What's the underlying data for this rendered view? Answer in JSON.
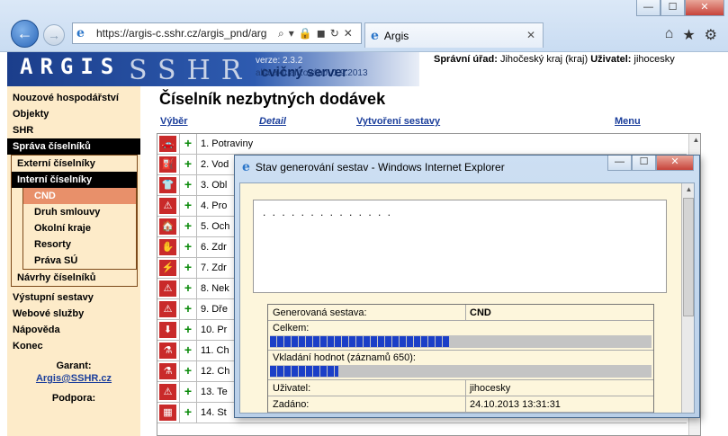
{
  "browser": {
    "url": "https://argis-c.sshr.cz/argis_pnd/arg",
    "tab_label": "Argis",
    "window_buttons": [
      "—",
      "☐",
      "✕"
    ],
    "icons": [
      "home-icon",
      "star-icon",
      "gear-icon"
    ]
  },
  "banner": {
    "logo": "ARGIS",
    "logo_bg": "SSHR",
    "subtitle": "cvičný server",
    "version": "verze: 2.3.2",
    "updated": "alfa aktualizováno: 1.9.2013"
  },
  "header": {
    "office_label": "Správní úřad:",
    "office_value": "Jihočeský kraj (kraj)",
    "user_label": "Uživatel:",
    "user_value": "jihocesky"
  },
  "sidebar": {
    "items_top": [
      "Nouzové hospodářství",
      "Objekty",
      "SHR"
    ],
    "section": "Správa číselníků",
    "sub1": "Externí číselníky",
    "sub2": "Interní číselníky",
    "inner": [
      "CND",
      "Druh smlouvy",
      "Okolní kraje",
      "Resorty",
      "Práva SÚ"
    ],
    "sub3": "Návrhy číselníků",
    "items_bottom": [
      "Výstupní sestavy",
      "Webové služby",
      "Nápověda",
      "Konec"
    ],
    "garant_label": "Garant:",
    "garant_mail": "Argis@SSHR.cz",
    "podpora_label": "Podpora:"
  },
  "main": {
    "title": "Číselník nezbytných dodávek",
    "links": [
      "Výběr",
      "Detail",
      "Vytvoření sestavy",
      "Menu"
    ],
    "rows": [
      "1.  Potraviny",
      "2.  Vod",
      "3.  Obl",
      "4.  Pro",
      "5.  Och",
      "6.  Zdr",
      "7.  Zdr",
      "8.  Nek",
      "9.  Dře",
      "10.  Pr",
      "11.  Ch",
      "12.  Ch",
      "13.  Te",
      "14.  St"
    ]
  },
  "dialog": {
    "title": "Stav generování sestav - Windows Internet Explorer",
    "dots": ". . . . . . . . . . . . . .",
    "fields": {
      "sestava_label": "Generovaná sestava:",
      "sestava_value": "CND",
      "celkem_label": "Celkem:",
      "celkem_progress": 0.47,
      "vkladani_label": "Vkladání hodnot (záznamů  650):",
      "vkladani_progress": 0.18,
      "uzivatel_label": "Uživatel:",
      "uzivatel_value": "jihocesky",
      "zadano_label": "Zadáno:",
      "zadano_value": "24.10.2013 13:31:31"
    }
  }
}
